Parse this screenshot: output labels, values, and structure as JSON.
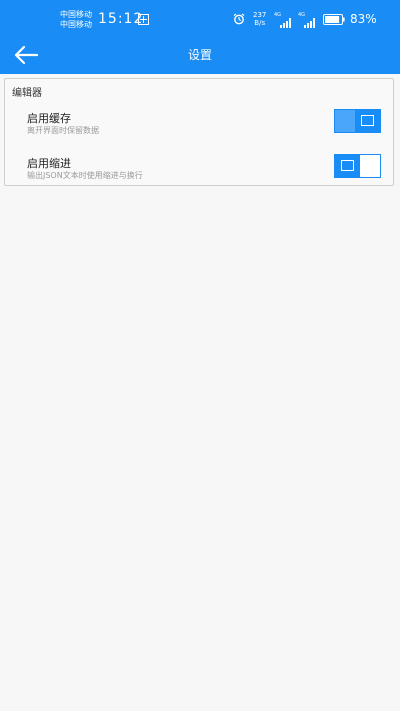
{
  "status_bar": {
    "carrier_1": "中国移动",
    "carrier_2": "中国移动",
    "time": "15:12",
    "net_speed_value": "237",
    "net_speed_unit": "B/s",
    "signal_tag": "4G",
    "battery_percent": "83%",
    "battery_level": 0.83,
    "icons": [
      "grid-icon",
      "alarm-icon",
      "signal-icon",
      "signal-icon",
      "battery-icon"
    ]
  },
  "app_bar": {
    "back_icon": "arrow-left-icon",
    "title": "设置"
  },
  "editor_section": {
    "title": "编辑器",
    "settings": [
      {
        "title": "启用缓存",
        "description": "离开界面时保留数据",
        "enabled": true
      },
      {
        "title": "启用缩进",
        "description": "输出JSON文本时使用缩进与换行",
        "enabled": false
      }
    ]
  },
  "colors": {
    "accent": "#1a8cf5",
    "toggle_track": "#4aa6fb",
    "background": "#f7f7f7",
    "card_border": "#cfcfcf"
  }
}
